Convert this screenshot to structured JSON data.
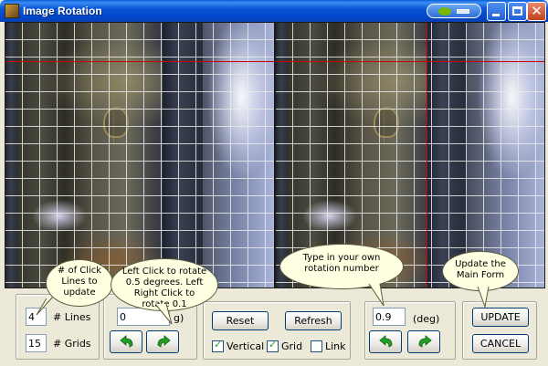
{
  "window": {
    "title": "Image Rotation",
    "controls": [
      "minimize",
      "maximize",
      "close"
    ]
  },
  "icons": {
    "app": "image-rotation-app-icon",
    "nvidia": "nvidia-taskbar-icon",
    "rotate_left": "rotate-ccw-arrow-icon",
    "rotate_right": "rotate-cw-arrow-icon"
  },
  "colors": {
    "titlebar": "#0755d6",
    "arrows": "#21a121",
    "guide_lines": "#d00000",
    "grid": "#ebebeb",
    "callout_bg": "#ffffe1"
  },
  "lines_group": {
    "lines_value": "4",
    "lines_label": "# Lines",
    "grids_value": "15",
    "grids_label": "# Grids"
  },
  "rotation_group": {
    "value": "0",
    "partial_label": "g)"
  },
  "options_group": {
    "reset_label": "Reset",
    "refresh_label": "Refresh",
    "vertical_label": "Vertical",
    "vertical_checked": true,
    "grid_label": "Grid",
    "grid_checked": true,
    "link_label": "Link",
    "link_checked": false
  },
  "custom_group": {
    "value": "0.9",
    "unit_label": "(deg)"
  },
  "actions": {
    "update_label": "UPDATE",
    "cancel_label": "CANCEL"
  },
  "callouts": {
    "lines": "# of Click Lines to update",
    "rotate": "Left Click to rotate 0.5 degrees. Left Right Click to rotate 0.1",
    "custom": "Type in your own rotation number",
    "update": "Update the Main Form"
  }
}
